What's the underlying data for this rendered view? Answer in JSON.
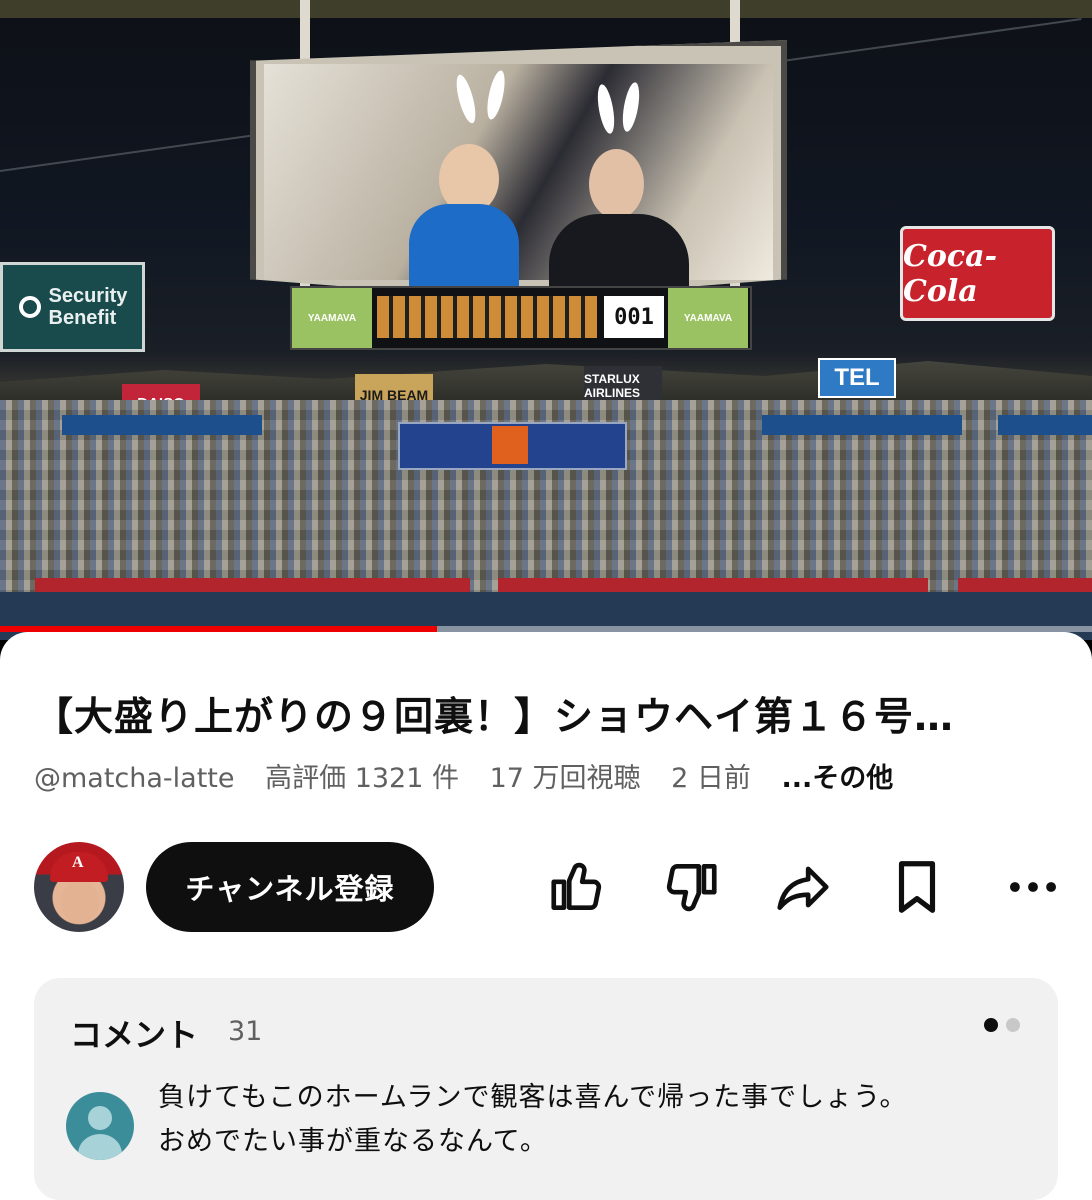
{
  "video": {
    "thumbnail_signs": {
      "security": "Security Benefit",
      "coca_cola": "Coca-Cola",
      "tel": "TEL",
      "daiso": "DAISO",
      "jim_beam": "JIM BEAM",
      "starlux": "STARLUX AIRLINES",
      "yaamava": "YAAMAVA",
      "score": "001"
    },
    "progress_fraction": 0.4
  },
  "details": {
    "title": "【大盛り上がりの９回裏！】ショウヘイ第１６号…",
    "channel_handle": "@matcha-latte",
    "likes": "高評価 1321 件",
    "views": "17 万回視聴",
    "age": "2 日前",
    "more_label": "...その他"
  },
  "actions": {
    "subscribe_label": "チャンネル登録",
    "icons": [
      "like-icon",
      "dislike-icon",
      "share-icon",
      "save-icon",
      "more-icon"
    ]
  },
  "comments": {
    "title": "コメント",
    "count": "31",
    "page_dots": 2,
    "active_dot": 0,
    "top_comment": {
      "line1": "負けてもこのホームランで観客は喜んで帰った事でしょう。",
      "line2": "おめでたい事が重なるなんて。"
    }
  },
  "colors": {
    "progress": "#ff0000",
    "text_primary": "#0f0f0f",
    "text_secondary": "#606060",
    "card_bg": "#f1f1f1"
  }
}
